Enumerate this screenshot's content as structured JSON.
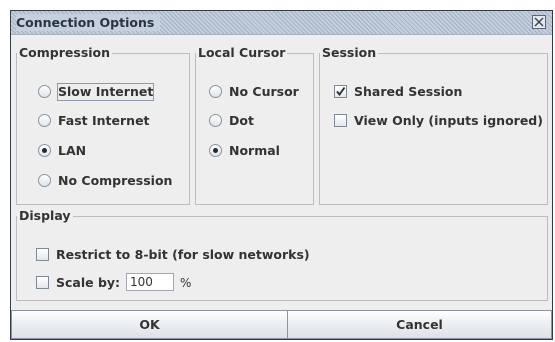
{
  "dialog": {
    "title": "Connection Options"
  },
  "compression": {
    "legend": "Compression",
    "options": [
      {
        "label": "Slow Internet",
        "checked": false
      },
      {
        "label": "Fast Internet",
        "checked": false
      },
      {
        "label": "LAN",
        "checked": true
      },
      {
        "label": "No Compression",
        "checked": false
      }
    ]
  },
  "local_cursor": {
    "legend": "Local Cursor",
    "options": [
      {
        "label": "No Cursor",
        "checked": false
      },
      {
        "label": "Dot",
        "checked": false
      },
      {
        "label": "Normal",
        "checked": true
      }
    ]
  },
  "session": {
    "legend": "Session",
    "shared_session": {
      "label": "Shared Session",
      "checked": true
    },
    "view_only": {
      "label": "View Only (inputs ignored)",
      "checked": false
    }
  },
  "display": {
    "legend": "Display",
    "restrict_8bit": {
      "label": "Restrict to 8-bit (for slow networks)",
      "checked": false
    },
    "scale": {
      "label": "Scale by:",
      "checked": false,
      "value": "100",
      "unit": "%"
    }
  },
  "buttons": {
    "ok": "OK",
    "cancel": "Cancel"
  },
  "icons": {
    "close": "close-icon",
    "check": "checkmark-icon"
  }
}
